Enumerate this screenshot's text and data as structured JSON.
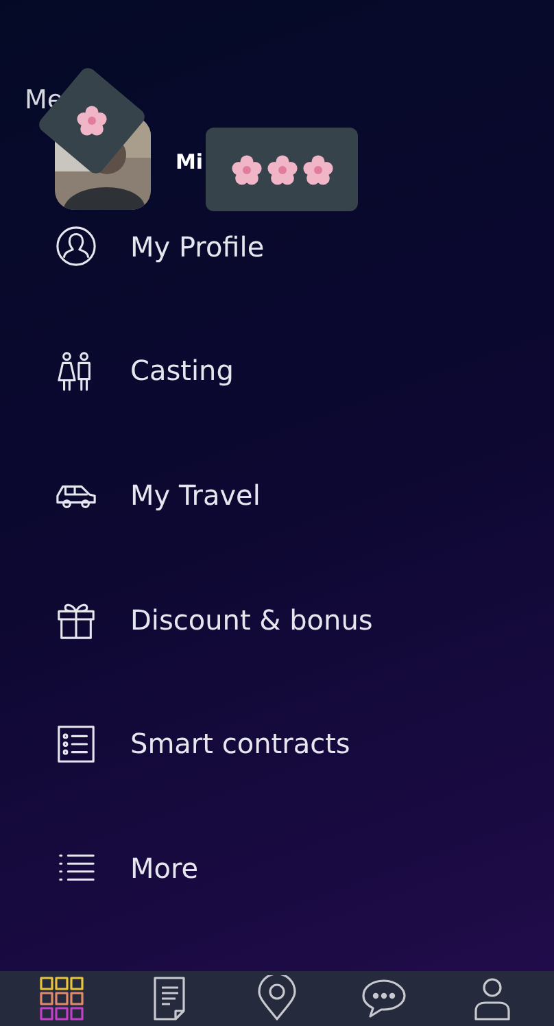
{
  "header": {
    "title": "Me",
    "user_name": "Mi"
  },
  "menu": [
    {
      "kind": "profile",
      "label": "My Profile"
    },
    {
      "kind": "casting",
      "label": "Casting"
    },
    {
      "kind": "travel",
      "label": "My Travel"
    },
    {
      "kind": "gift",
      "label": "Discount & bonus"
    },
    {
      "kind": "contracts",
      "label": "Smart contracts"
    },
    {
      "kind": "more",
      "label": "More"
    }
  ],
  "bottom_nav": [
    {
      "kind": "grid",
      "selected": true
    },
    {
      "kind": "document",
      "selected": false
    },
    {
      "kind": "location",
      "selected": false
    },
    {
      "kind": "chat",
      "selected": false
    },
    {
      "kind": "user",
      "selected": false
    }
  ]
}
